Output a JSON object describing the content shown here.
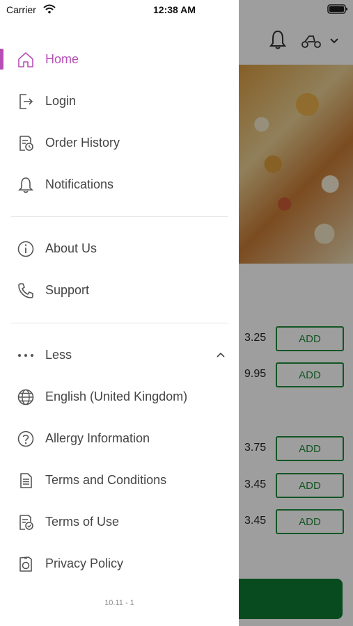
{
  "status_bar": {
    "carrier": "Carrier",
    "time": "12:38 AM"
  },
  "menu": {
    "items_top": [
      {
        "label": "Home",
        "icon": "home-icon"
      },
      {
        "label": "Login",
        "icon": "login-icon"
      },
      {
        "label": "Order History",
        "icon": "order-history-icon"
      },
      {
        "label": "Notifications",
        "icon": "bell-icon"
      }
    ],
    "items_mid": [
      {
        "label": "About Us",
        "icon": "info-icon"
      },
      {
        "label": "Support",
        "icon": "phone-icon"
      }
    ],
    "less_label": "Less",
    "items_bottom": [
      {
        "label": "English (United Kingdom)",
        "icon": "globe-icon"
      },
      {
        "label": "Allergy Information",
        "icon": "question-icon"
      },
      {
        "label": "Terms and Conditions",
        "icon": "document-icon"
      },
      {
        "label": "Terms of Use",
        "icon": "document-check-icon"
      },
      {
        "label": "Privacy Policy",
        "icon": "privacy-icon"
      }
    ]
  },
  "version": "10.11 - 1",
  "background": {
    "prices": [
      "3.25",
      "9.95",
      "3.75",
      "3.45",
      "3.45"
    ],
    "add_label": "ADD"
  },
  "colors": {
    "accent": "#b64fb5",
    "green": "#1f8a3a"
  }
}
